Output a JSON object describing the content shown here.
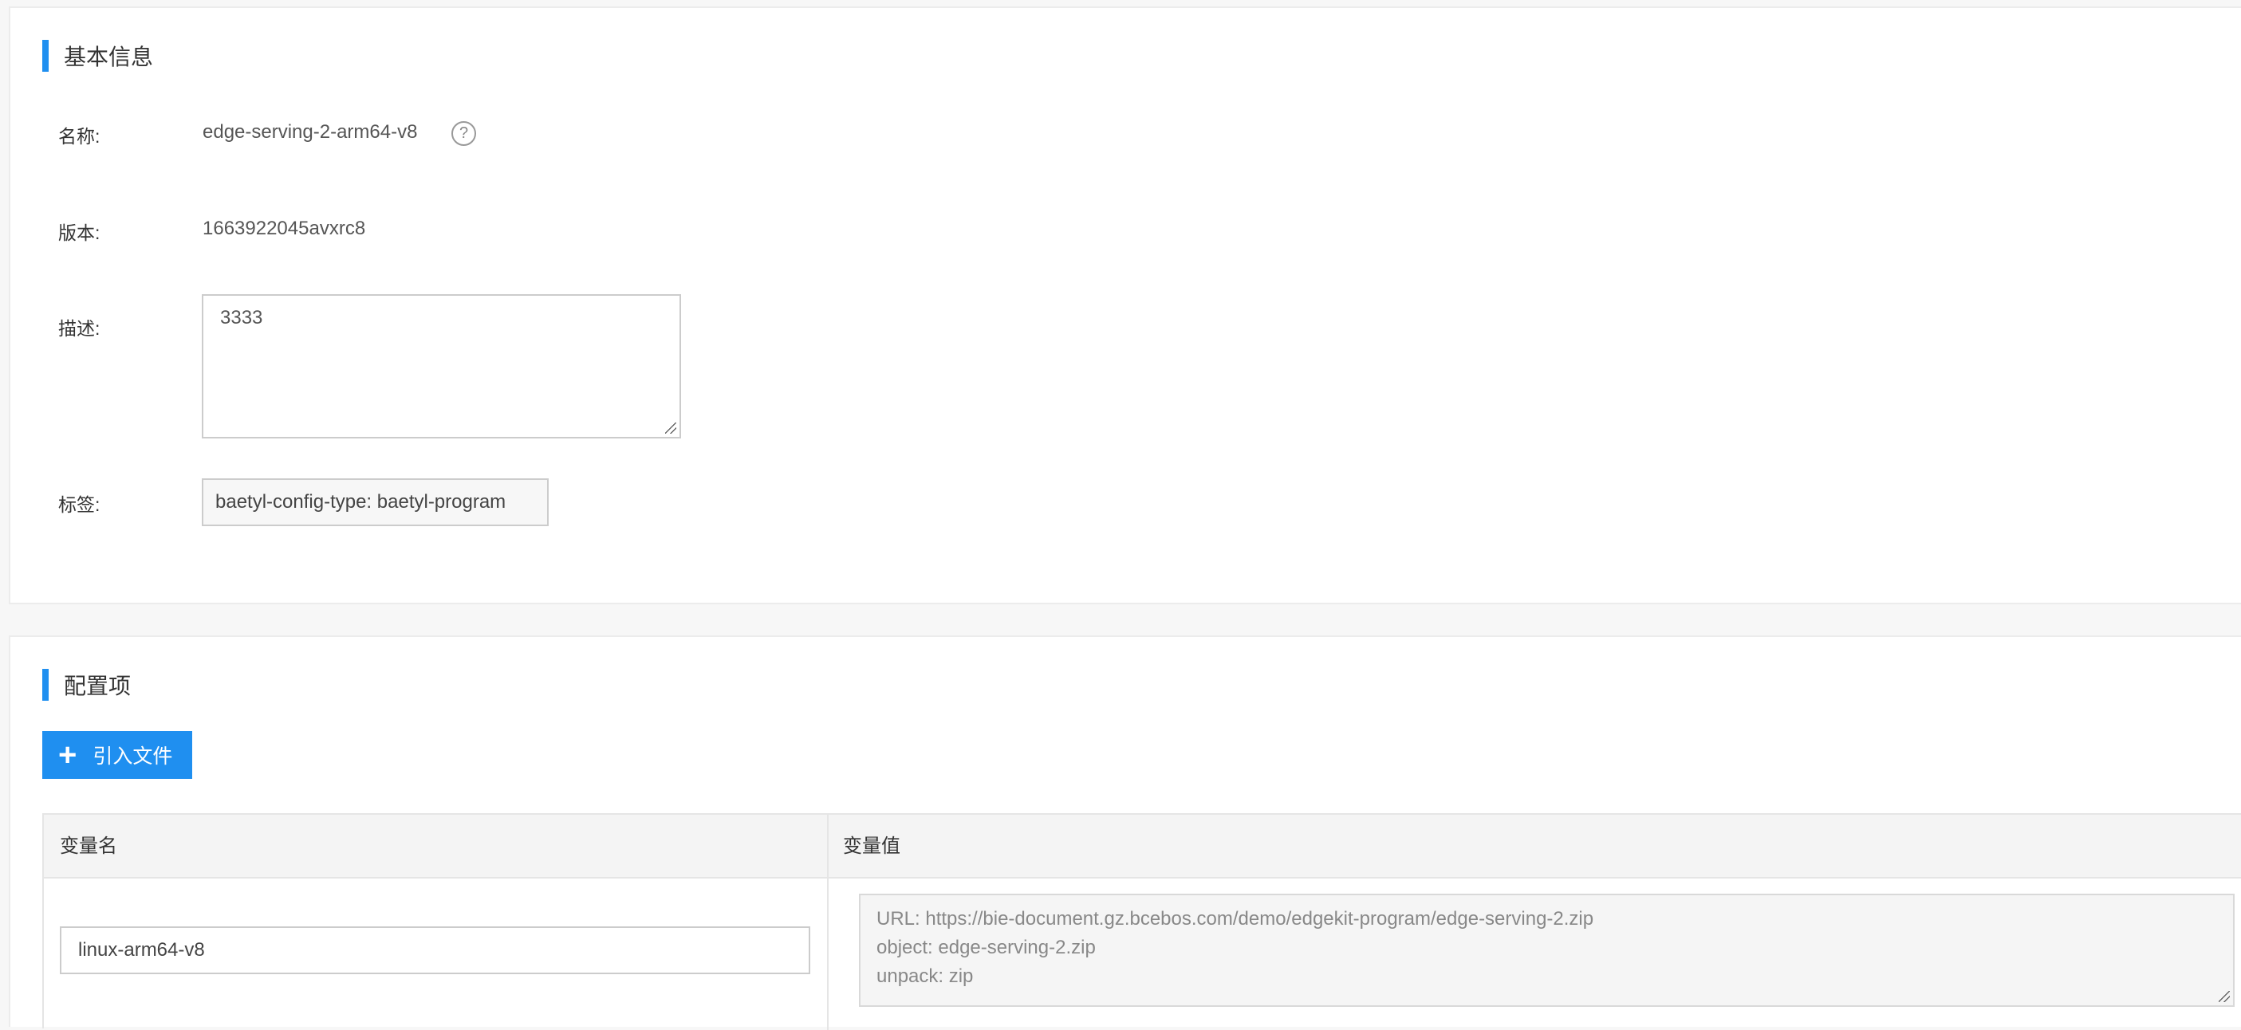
{
  "basic_info": {
    "section_title": "基本信息",
    "name_label": "名称:",
    "name_value": "edge-serving-2-arm64-v8",
    "version_label": "版本:",
    "version_value": "1663922045avxrc8",
    "description_label": "描述:",
    "description_value": "3333",
    "tags_label": "标签:",
    "tags_value": "baetyl-config-type: baetyl-program",
    "help_icon": "?"
  },
  "config": {
    "section_title": "配置项",
    "import_button_label": "引入文件",
    "import_button_icon": "+",
    "table": {
      "columns": [
        "变量名",
        "变量值"
      ],
      "rows": [
        {
          "name": "linux-arm64-v8",
          "value_lines": [
            "URL: https://bie-document.gz.bcebos.com/demo/edgekit-program/edge-serving-2.zip",
            "object: edge-serving-2.zip",
            "unpack: zip"
          ]
        }
      ]
    }
  },
  "colors": {
    "accent": "#1f8ff0"
  }
}
